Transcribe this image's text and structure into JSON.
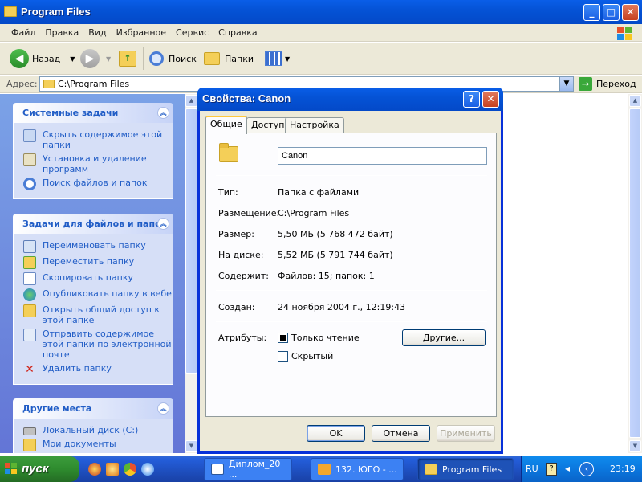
{
  "window": {
    "title": "Program Files",
    "colors": {
      "title_bar": "#0553d6",
      "task_pane_link": "#215dc6",
      "close": "#c6401f"
    }
  },
  "menu": [
    "Файл",
    "Правка",
    "Вид",
    "Избранное",
    "Сервис",
    "Справка"
  ],
  "toolbar": {
    "back_label": "Назад",
    "search_label": "Поиск",
    "folders_label": "Папки"
  },
  "address": {
    "label": "Адрес:",
    "value": "C:\\Program Files",
    "go_label": "Переход"
  },
  "task_pane": {
    "system_tasks": {
      "title": "Системные задачи",
      "items": [
        {
          "label": "Скрыть содержимое этой папки",
          "icon": "folder-view-icon"
        },
        {
          "label": "Установка и удаление программ",
          "icon": "add-remove-programs-icon"
        },
        {
          "label": "Поиск файлов и папок",
          "icon": "search-icon"
        }
      ]
    },
    "file_tasks": {
      "title": "Задачи для файлов и папок",
      "items": [
        {
          "label": "Переименовать папку",
          "icon": "rename-icon"
        },
        {
          "label": "Переместить папку",
          "icon": "move-icon"
        },
        {
          "label": "Скопировать папку",
          "icon": "copy-icon"
        },
        {
          "label": "Опубликовать папку в вебе",
          "icon": "publish-web-icon"
        },
        {
          "label": "Открыть общий доступ к этой папке",
          "icon": "share-icon"
        },
        {
          "label": "Отправить содержимое этой папки по электронной почте",
          "icon": "email-icon"
        },
        {
          "label": "Удалить папку",
          "icon": "delete-icon"
        }
      ]
    },
    "other_places": {
      "title": "Другие места",
      "items": [
        {
          "label": "Локальный диск (C:)",
          "icon": "drive-icon"
        },
        {
          "label": "Мои документы",
          "icon": "my-documents-icon"
        }
      ]
    }
  },
  "dialog": {
    "title": "Свойства: Canon",
    "tabs": [
      "Общие",
      "Доступ",
      "Настройка"
    ],
    "active_tab": "Общие",
    "name_value": "Canon",
    "props": {
      "type_label": "Тип:",
      "type_value": "Папка с файлами",
      "location_label": "Размещение:",
      "location_value": "C:\\Program Files",
      "size_label": "Размер:",
      "size_value": "5,50 МБ (5 768 472 байт)",
      "ondisk_label": "На диске:",
      "ondisk_value": "5,52 МБ (5 791 744 байт)",
      "contains_label": "Содержит:",
      "contains_value": "Файлов: 15; папок: 1",
      "created_label": "Создан:",
      "created_value": "24 ноября 2004 г., 12:19:43",
      "attributes_label": "Атрибуты:"
    },
    "attributes": {
      "readonly_label": "Только чтение",
      "readonly_checked": true,
      "hidden_label": "Скрытый",
      "hidden_checked": false,
      "other_button": "Другие..."
    },
    "buttons": {
      "ok": "OK",
      "cancel": "Отмена",
      "apply": "Применить"
    }
  },
  "taskbar": {
    "start_label": "пуск",
    "tasks": [
      {
        "label": "Диплом_20 ...",
        "icon": "word-doc-icon",
        "active": false
      },
      {
        "label": "132. ЮГО - ...",
        "icon": "app-icon",
        "active": false
      },
      {
        "label": "Program Files",
        "icon": "folder-icon",
        "active": true
      }
    ],
    "tray": {
      "lang": "RU",
      "clock": "23:19"
    }
  }
}
